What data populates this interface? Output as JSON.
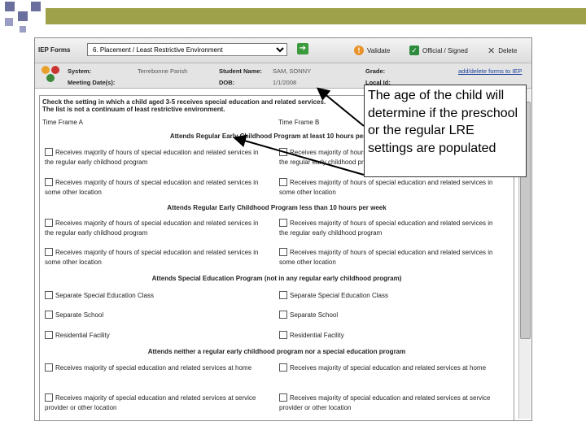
{
  "toolbar": {
    "iep_forms_label": "IEP Forms",
    "form_select_value": "6. Placement / Least Restrictive Environment",
    "go_button": "➔",
    "validate_label": "Validate",
    "official_signed_label": "Official / Signed",
    "delete_label": "Delete"
  },
  "info": {
    "system_label": "System:",
    "system_value": "Terrebonne Parish",
    "student_name_label": "Student Name:",
    "student_name_value": "SAM, SONNY",
    "grade_label": "Grade:",
    "add_delete_link": "add/delete forms to IEP",
    "meeting_date_label": "Meeting Date(s):",
    "dob_label": "DOB:",
    "dob_value": "1/1/2008",
    "local_id_label": "Local Id:"
  },
  "form": {
    "instruction_line1": "Check the setting in which a child aged 3-5 receives special education and related services.",
    "instruction_line2": "The list is not a continuum of least restrictive environment.",
    "time_frame_a": "Time Frame A",
    "time_frame_b": "Time Frame B",
    "sections": [
      {
        "header": "Attends Regular Early Childhood Program at least 10 hours per week",
        "options": [
          "Receives majority of hours of special education and related services in the regular early childhood program",
          "Receives majority of hours of special education and related services in some other location"
        ]
      },
      {
        "header": "Attends Regular Early Childhood Program less than 10 hours per week",
        "options": [
          "Receives majority of hours of special education and related services in the regular early childhood program",
          "Receives majority of hours of special education and related services in some other location"
        ]
      },
      {
        "header": "Attends Special Education Program (not in any regular early childhood program)",
        "options": [
          "Separate Special Education Class",
          "Separate School",
          "Residential Facility"
        ]
      },
      {
        "header": "Attends neither a regular early childhood program nor a special education program",
        "options": [
          "Receives majority of special education and related services at home",
          "Receives majority of special education and related services at service provider or other location"
        ]
      }
    ]
  },
  "callout": {
    "text": "The age of the child will determine if the preschool or the regular LRE settings are populated"
  },
  "colors": {
    "olive_bar": "#9ea04a",
    "deco_squares": "#6a6f9d",
    "link": "#1a3f9a"
  }
}
